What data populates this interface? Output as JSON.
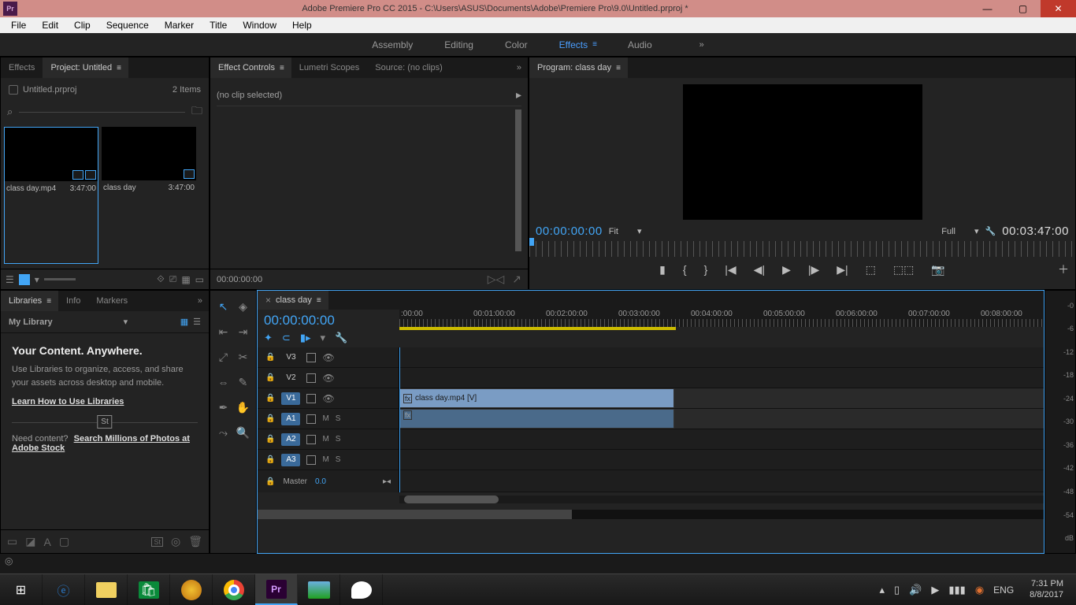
{
  "titlebar": {
    "app_label": "Pr",
    "title": "Adobe Premiere Pro CC 2015 - C:\\Users\\ASUS\\Documents\\Adobe\\Premiere Pro\\9.0\\Untitled.prproj *"
  },
  "menu": [
    "File",
    "Edit",
    "Clip",
    "Sequence",
    "Marker",
    "Title",
    "Window",
    "Help"
  ],
  "workspaces": {
    "items": [
      "Assembly",
      "Editing",
      "Color",
      "Effects",
      "Audio"
    ],
    "active": "Effects"
  },
  "project": {
    "tabs": {
      "effects": "Effects",
      "project": "Project: Untitled"
    },
    "bin_name": "Untitled.prproj",
    "item_count": "2 Items",
    "bins": [
      {
        "name": "class day.mp4",
        "duration": "3:47:00",
        "selected": true
      },
      {
        "name": "class day",
        "duration": "3:47:00",
        "selected": false
      }
    ]
  },
  "effect_controls": {
    "tabs": [
      "Effect Controls",
      "Lumetri Scopes",
      "Source: (no clips)"
    ],
    "no_clip": "(no clip selected)",
    "footer_tc": "00:00:00:00"
  },
  "program": {
    "title": "Program: class day",
    "tc_left": "00:00:00:00",
    "fit": "Fit",
    "full": "Full",
    "tc_right": "00:03:47:00"
  },
  "libraries": {
    "tabs": [
      "Libraries",
      "Info",
      "Markers"
    ],
    "dropdown": "My Library",
    "headline": "Your Content. Anywhere.",
    "body": "Use Libraries to organize, access, and share your assets across desktop and mobile.",
    "learn_link": "Learn How to Use Libraries",
    "st_label": "St",
    "need": "Need content?",
    "stock_link": "Search Millions of Photos at Adobe Stock"
  },
  "timeline": {
    "seq_name": "class day",
    "tc": "00:00:00:00",
    "ruler": [
      ":00:00",
      "00:01:00:00",
      "00:02:00:00",
      "00:03:00:00",
      "00:04:00:00",
      "00:05:00:00",
      "00:06:00:00",
      "00:07:00:00",
      "00:08:00:00"
    ],
    "video_tracks": [
      "V3",
      "V2",
      "V1"
    ],
    "audio_tracks": [
      "A1",
      "A2",
      "A3"
    ],
    "clip_video": "class day.mp4 [V]",
    "master_label": "Master",
    "master_val": "0.0"
  },
  "audio_meters": [
    "-0",
    "--",
    "-6",
    "--",
    "-12",
    "--",
    "-18",
    "--",
    "-24",
    "--",
    "-30",
    "--",
    "-36",
    "--",
    "-42",
    "--",
    "-48",
    "--",
    "-54",
    "--",
    "dB"
  ],
  "taskbar": {
    "lang": "ENG",
    "time": "7:31 PM",
    "date": "8/8/2017"
  }
}
